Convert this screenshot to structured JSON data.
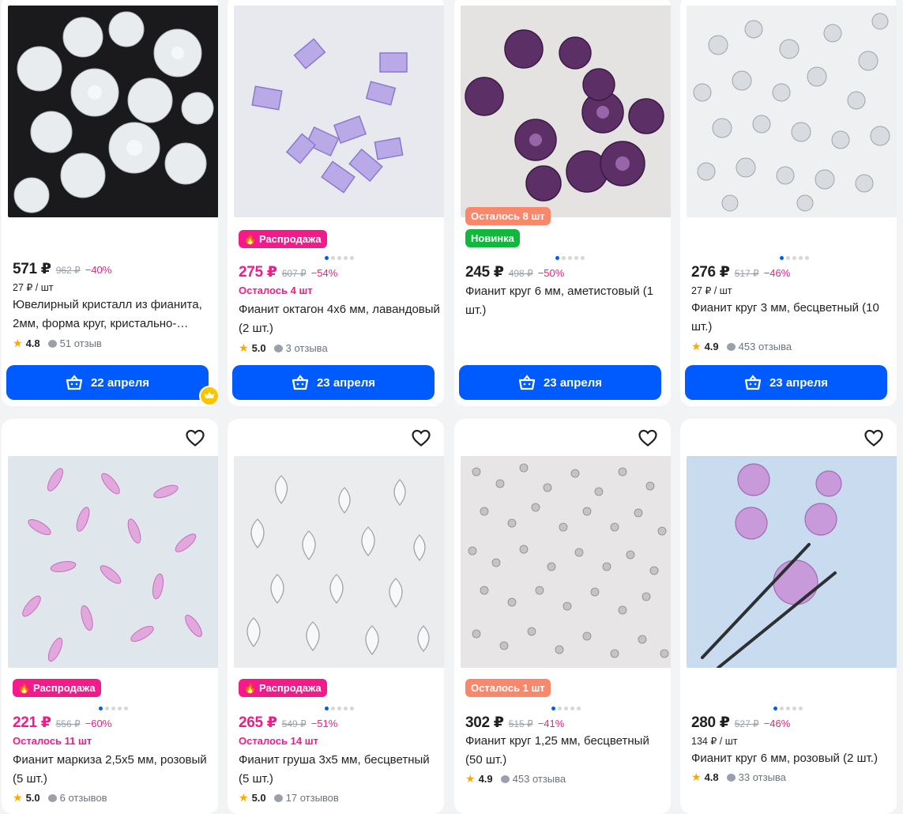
{
  "products": [
    {
      "price": "571 ₽",
      "old": "962 ₽",
      "disc": "−40%",
      "unit": "27 ₽ / шт",
      "title": "Ювелирный кристалл из фианита, 2мм, форма круг, кристально-…",
      "rating": "4.8",
      "reviews": "51 отзыв",
      "button": "22 апреля"
    },
    {
      "badge": "Распродажа",
      "price": "275 ₽",
      "old": "607 ₽",
      "disc": "−54%",
      "stock": "Осталось 4 шт",
      "title": "Фианит октагон 4x6 мм, лавандовый (2 шт.)",
      "rating": "5.0",
      "reviews": "3 отзыва",
      "button": "23 апреля"
    },
    {
      "badge_left": "Осталось 8 шт",
      "badge_new": "Новинка",
      "price": "245 ₽",
      "old": "498 ₽",
      "disc": "−50%",
      "title": "Фианит круг 6 мм, аметистовый (1 шт.)",
      "button": "23 апреля"
    },
    {
      "price": "276 ₽",
      "old": "517 ₽",
      "disc": "−46%",
      "unit": "27 ₽ / шт",
      "title": "Фианит круг 3 мм, бесцветный (10 шт.)",
      "rating": "4.9",
      "reviews": "453 отзыва",
      "button": "23 апреля"
    },
    {
      "badge": "Распродажа",
      "price": "221 ₽",
      "old": "556 ₽",
      "disc": "−60%",
      "stock": "Осталось 11 шт",
      "title": "Фианит маркиза 2,5x5 мм, розовый (5 шт.)",
      "rating": "5.0",
      "reviews": "6 отзывов"
    },
    {
      "badge": "Распродажа",
      "price": "265 ₽",
      "old": "549 ₽",
      "disc": "−51%",
      "stock": "Осталось 14 шт",
      "title": "Фианит груша 3x5 мм, бесцветный (5 шт.)",
      "rating": "5.0",
      "reviews": "17 отзывов"
    },
    {
      "badge_left": "Осталось 1 шт",
      "price": "302 ₽",
      "old": "515 ₽",
      "disc": "−41%",
      "title": "Фианит круг 1,25 мм, бесцветный (50 шт.)",
      "rating": "4.9",
      "reviews": "453 отзыва"
    },
    {
      "price": "280 ₽",
      "old": "527 ₽",
      "disc": "−46%",
      "unit": "134 ₽ / шт",
      "title": "Фианит круг 6 мм, розовый (2 шт.)",
      "rating": "4.8",
      "reviews": "33 отзыва"
    }
  ],
  "colors": {
    "accent": "#005bff",
    "sale": "#f31b8b",
    "left": "#f9876b",
    "new": "#12b83d",
    "star": "#ffa800"
  },
  "icons": {
    "cart": "basket-icon",
    "favorite": "heart-icon",
    "sale": "fire-icon",
    "premium": "crown-icon"
  }
}
